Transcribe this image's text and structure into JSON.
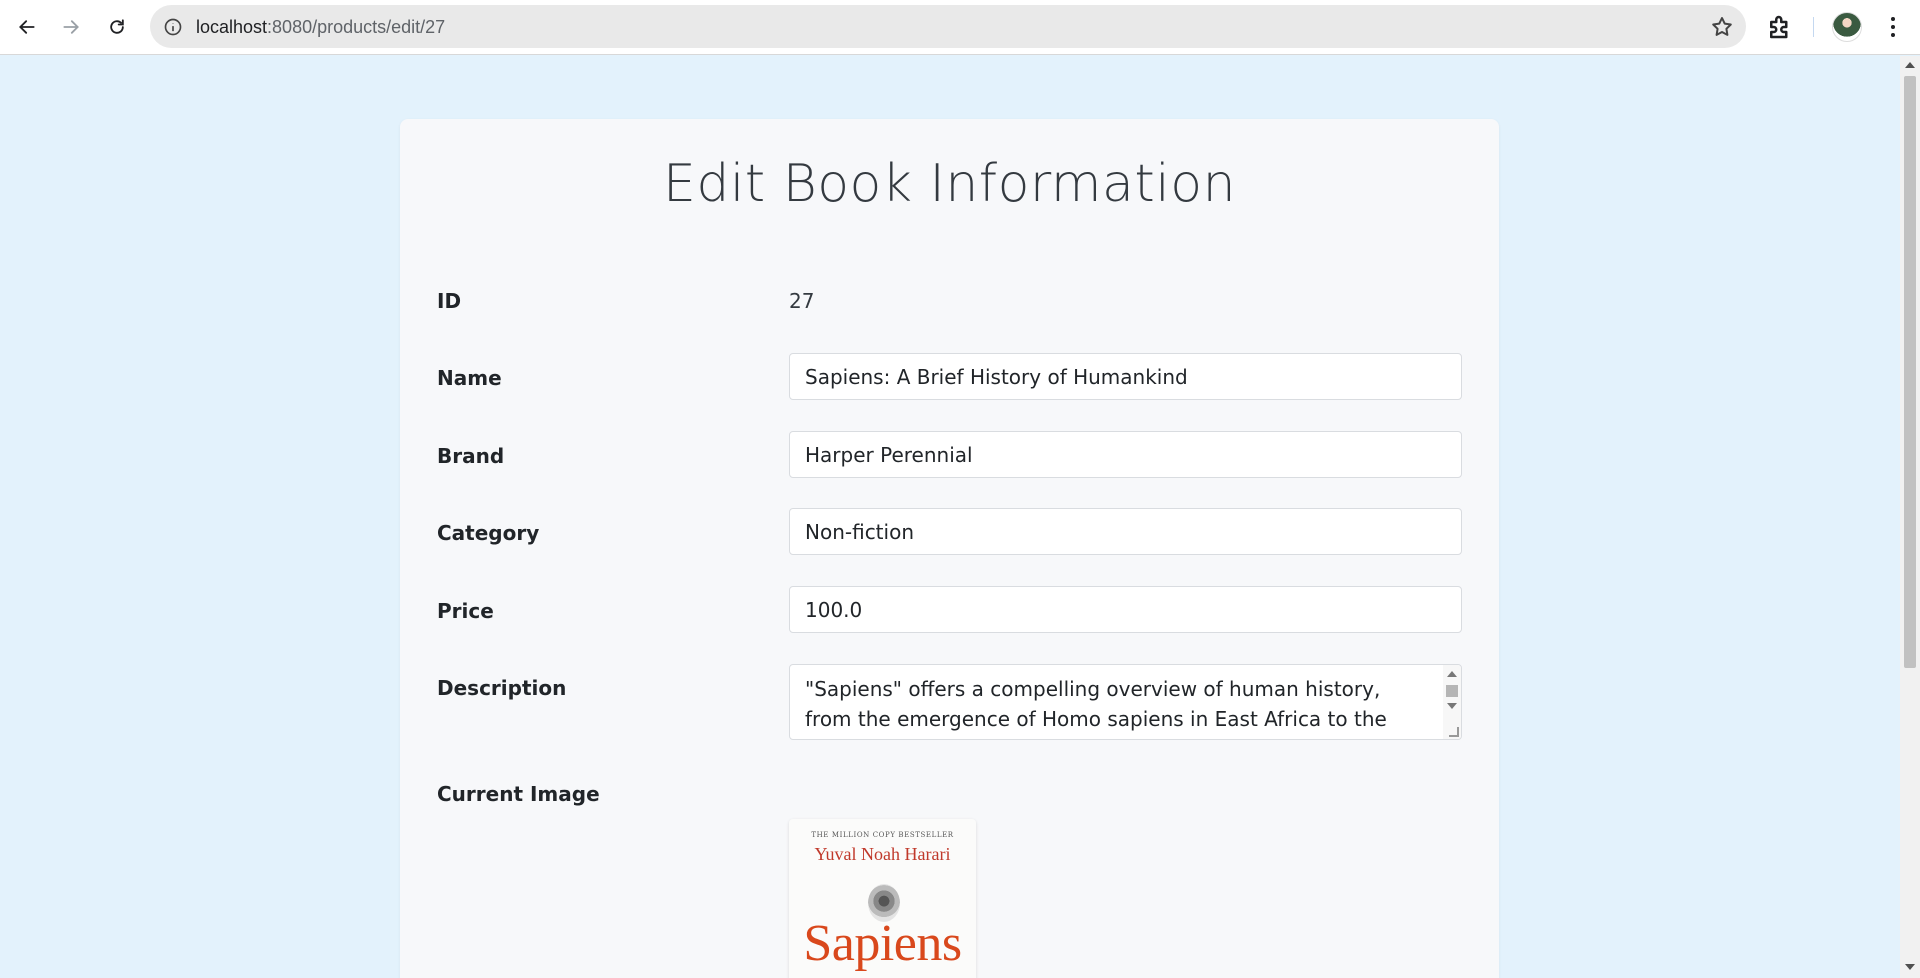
{
  "browser": {
    "url_host": "localhost",
    "url_path": ":8080/products/edit/27"
  },
  "page": {
    "title": "Edit Book Information"
  },
  "form": {
    "id": {
      "label": "ID",
      "value": "27"
    },
    "name": {
      "label": "Name",
      "value": "Sapiens: A Brief History of Humankind"
    },
    "brand": {
      "label": "Brand",
      "value": "Harper Perennial"
    },
    "category": {
      "label": "Category",
      "value": "Non-fiction"
    },
    "price": {
      "label": "Price",
      "value": "100.0"
    },
    "description": {
      "label": "Description",
      "value": "\"Sapiens\" offers a compelling overview of human history, from the emergence of Homo sapiens in East Africa to the present"
    },
    "current_image": {
      "label": "Current Image",
      "cover_tag": "THE MILLION COPY BESTSELLER",
      "cover_author": "Yuval Noah Harari",
      "cover_title": "Sapiens"
    }
  }
}
